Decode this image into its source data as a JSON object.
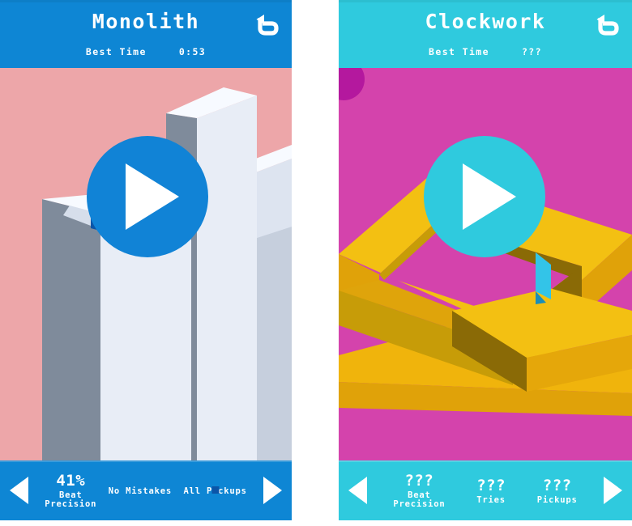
{
  "theme": {
    "left_header_bg": "#0E86D4",
    "left_footer_bg": "#0E86D4",
    "left_art_bg": "#EDA6A9",
    "left_accent": "#1183D6",
    "right_header_bg": "#2FCADE",
    "right_footer_bg": "#2FCADE",
    "right_art_bg": "#D443AC",
    "right_accent": "#2FCADE",
    "tower_light": "#E8EDF6",
    "tower_shadow": "#7F8B9B",
    "tower_top": "#F7FAFF",
    "beam_face": "#F3C012",
    "beam_top": "#F0B40C",
    "beam_dark": "#8A6A06",
    "pickup_badge": "#0B55A8"
  },
  "cards": [
    {
      "id": "monolith",
      "title": "Monolith",
      "best_time_label": "Best Time",
      "best_time_value": "0:53",
      "back_icon": "undo-arrow-icon",
      "play_icon": "play-icon",
      "prev_icon": "left-triangle-icon",
      "next_icon": "right-triangle-icon",
      "stats": [
        {
          "value": "41%",
          "label": "Beat\nPrecision",
          "badge": false
        },
        {
          "value": "",
          "label": "No Mistakes",
          "badge": false
        },
        {
          "value": "",
          "label": "All Pickups",
          "badge": true
        }
      ]
    },
    {
      "id": "clockwork",
      "title": "Clockwork",
      "best_time_label": "Best Time",
      "best_time_value": "???",
      "back_icon": "undo-arrow-icon",
      "play_icon": "play-icon",
      "prev_icon": "left-triangle-icon",
      "next_icon": "right-triangle-icon",
      "stats": [
        {
          "value": "???",
          "label": "Beat\nPrecision",
          "badge": false
        },
        {
          "value": "???",
          "label": "Tries",
          "badge": false
        },
        {
          "value": "???",
          "label": "Pickups",
          "badge": false
        }
      ]
    }
  ]
}
